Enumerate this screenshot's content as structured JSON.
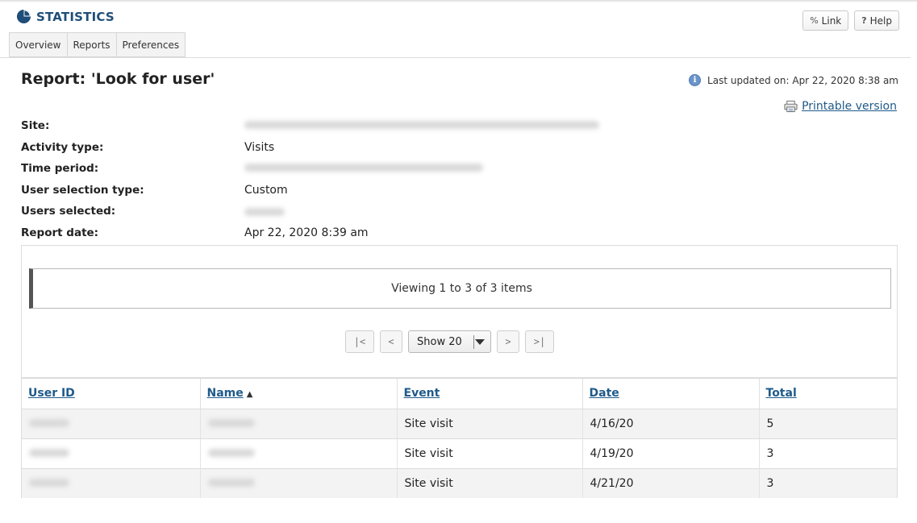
{
  "header": {
    "app_title": "STATISTICS",
    "link_label": "Link",
    "help_label": "Help",
    "help_icon_glyph": "?",
    "link_icon_glyph": "%"
  },
  "tabs": [
    {
      "label": "Overview"
    },
    {
      "label": "Reports"
    },
    {
      "label": "Preferences"
    }
  ],
  "report": {
    "title": "Report: 'Look for user'",
    "last_updated": "Last updated on: Apr 22, 2020 8:38 am",
    "printable_label": "Printable version"
  },
  "meta": {
    "site_label": "Site:",
    "activity_label": "Activity type:",
    "activity_value": "Visits",
    "period_label": "Time period:",
    "selection_label": "User selection type:",
    "selection_value": "Custom",
    "users_label": "Users selected:",
    "date_label": "Report date:",
    "date_value": "Apr 22, 2020 8:39 am"
  },
  "viewing_text": "Viewing 1 to 3 of 3 items",
  "pager": {
    "first": "|<",
    "prev": "<",
    "show": "Show 20",
    "next": ">",
    "last": ">|"
  },
  "table": {
    "columns": [
      "User ID",
      "Name",
      "Event",
      "Date",
      "Total"
    ],
    "rows": [
      {
        "event": "Site visit",
        "date": "4/16/20",
        "total": "5"
      },
      {
        "event": "Site visit",
        "date": "4/19/20",
        "total": "3"
      },
      {
        "event": "Site visit",
        "date": "4/21/20",
        "total": "3"
      }
    ]
  },
  "colors": {
    "brand": "#1f4e79",
    "link": "#1f5a8a",
    "info": "#6b95c9"
  }
}
